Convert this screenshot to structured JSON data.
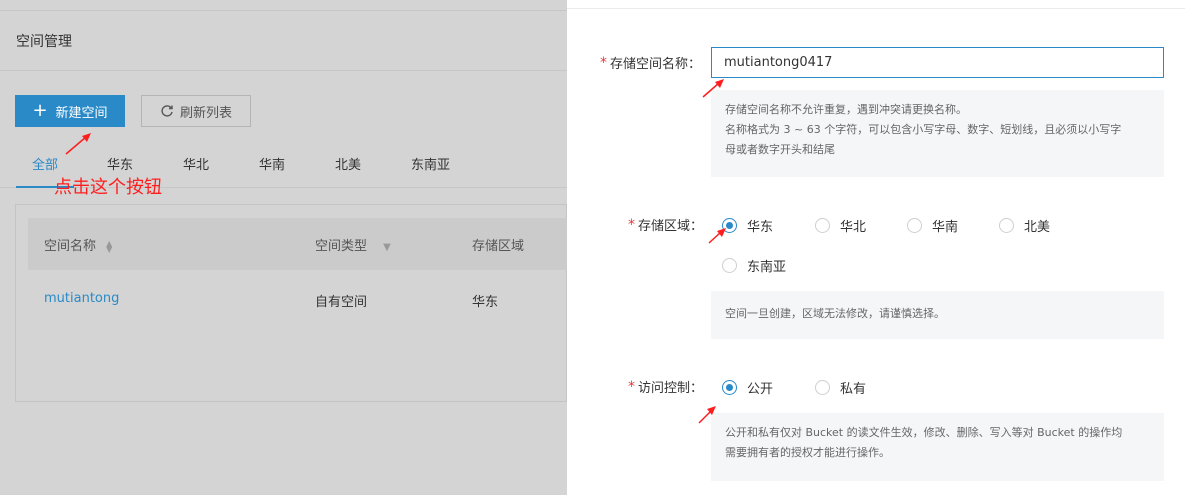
{
  "left": {
    "title": "空间管理",
    "new_button": "新建空间",
    "refresh_button": "刷新列表",
    "tabs": [
      "全部",
      "华东",
      "华北",
      "华南",
      "北美",
      "东南亚"
    ],
    "annotation": "点击这个按钮",
    "table": {
      "headers": [
        "空间名称",
        "空间类型",
        "存储区域"
      ],
      "rows": [
        [
          "mutiantong",
          "自有空间",
          "华东"
        ]
      ]
    }
  },
  "drawer": {
    "name_label": "存储空间名称：",
    "name_value": "mutiantong0417",
    "name_hint_1": "存储空间名称不允许重复，遇到冲突请更换名称。",
    "name_hint_2": "名称格式为 3 ~ 63 个字符，可以包含小写字母、数字、短划线，且必须以小写字",
    "name_hint_3": "母或者数字开头和结尾",
    "region_label": "存储区域：",
    "regions": [
      "华东",
      "华北",
      "华南",
      "北美",
      "东南亚"
    ],
    "region_selected": "华东",
    "region_hint": "空间一旦创建，区域无法修改，请谨慎选择。",
    "access_label": "访问控制：",
    "access_options": [
      "公开",
      "私有"
    ],
    "access_selected": "公开",
    "access_hint_1": "公开和私有仅对 Bucket 的读文件生效，修改、删除、写入等对 Bucket 的操作均",
    "access_hint_2": "需要拥有者的授权才能进行操作。",
    "required_mark": "*"
  },
  "colors": {
    "accent": "#2a8ac7",
    "required": "#e4393c",
    "annotation": "#ff1e1e"
  }
}
